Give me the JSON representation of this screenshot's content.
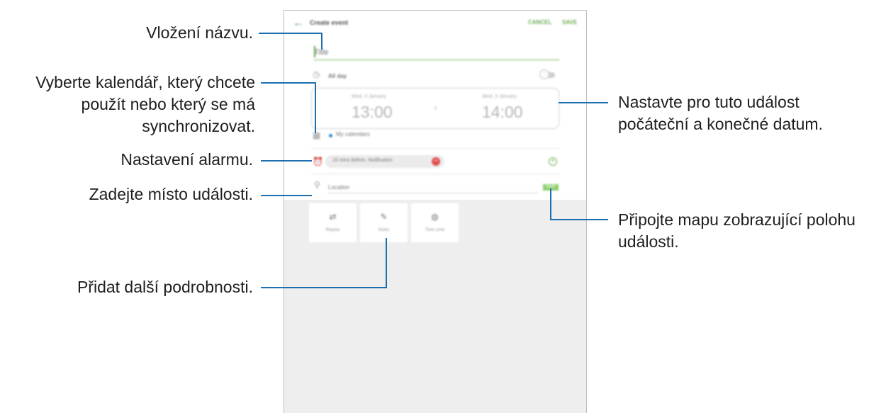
{
  "screen": {
    "appbar": {
      "title": "Create event",
      "cancel_label": "CANCEL",
      "save_label": "SAVE"
    },
    "title_placeholder": "Title",
    "all_day_label": "All day",
    "all_day_on": false,
    "start": {
      "date": "Wed, 3 January",
      "time": "13:00"
    },
    "end": {
      "date": "Wed, 3 January",
      "time": "14:00"
    },
    "arrow": "›",
    "calendar_label": "My calendars",
    "alarm_label": "15 mins before, Notification",
    "location_placeholder": "Location",
    "map_label": "MAP",
    "extras": [
      {
        "label": "Repeat",
        "icon": "repeat-icon",
        "glyph": "⇄"
      },
      {
        "label": "Notes",
        "icon": "notes-icon",
        "glyph": "✎"
      },
      {
        "label": "Time zone",
        "icon": "timezone-icon",
        "glyph": "◍"
      }
    ],
    "colors": {
      "accent": "#6fae55",
      "lower_bg": "#eeeeee",
      "leader": "#1e6fae",
      "calendar_dot": "#2a8bd0"
    }
  },
  "callouts": {
    "title": "Vložení názvu.",
    "calendar": [
      "Vyberte kalendář, který chcete",
      "použít nebo který se má",
      "synchronizovat."
    ],
    "alarm": "Nastavení alarmu.",
    "location": "Zadejte místo události.",
    "extras": "Přidat další podrobnosti.",
    "dates": [
      "Nastavte pro tuto událost",
      "počáteční a konečné datum."
    ],
    "map": [
      "Připojte mapu zobrazující polohu",
      "události."
    ]
  }
}
